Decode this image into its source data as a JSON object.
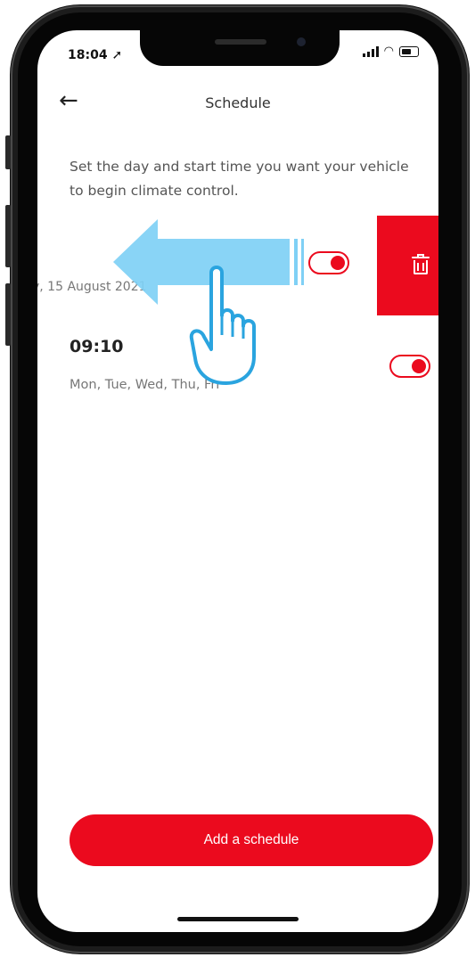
{
  "status_bar": {
    "time": "18:04 ➚"
  },
  "header": {
    "back_icon": "arrow-left-icon",
    "title": "Schedule"
  },
  "description": "Set the day and start time you want your vehicle to begin climate control.",
  "schedules": [
    {
      "date": "y, 15 August 2021",
      "enabled": true
    },
    {
      "time": "09:10",
      "days": "Mon, Tue, Wed, Thu, Fri",
      "enabled": true
    }
  ],
  "delete_action": {
    "icon": "trash-icon"
  },
  "add_button": {
    "label": "Add a schedule"
  },
  "colors": {
    "accent": "#eb0a1e",
    "hint": "#7fd0f5"
  }
}
